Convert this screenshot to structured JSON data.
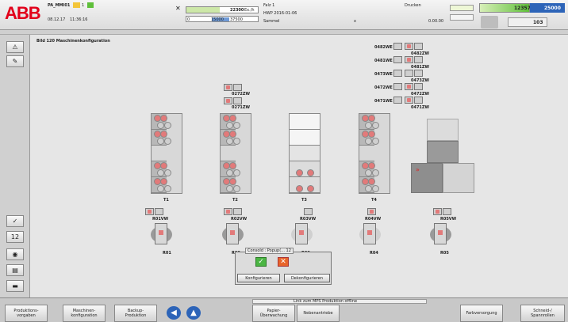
{
  "header": {
    "logo": "ABB",
    "machine": "PA_MMI01",
    "alarm_count": "1",
    "date": "08.12.17",
    "time": "11:36:16",
    "speed_value": "22300",
    "speed_unit": "Ex./h",
    "speed_marker": "15000",
    "speed_max": "37500",
    "speed_min": "0",
    "falz": "Falz 1",
    "product": "HWP 2016-01-06",
    "sammel": "Sammel",
    "sammel_x": "x",
    "druck_label": "Drucken",
    "druck_value": "0.00.00",
    "counter_current": "12357",
    "counter_target": "25000",
    "counter_sub": "103"
  },
  "page": {
    "title": "Bild 120 Maschinenkonfiguration"
  },
  "towers": [
    {
      "label": "T1"
    },
    {
      "label": "T2"
    },
    {
      "label": "T3"
    },
    {
      "label": "T4"
    }
  ],
  "turnbars": {
    "t2_top": "0272ZW",
    "t2_bottom": "0271ZW",
    "rows": [
      "0482WE",
      "0481WE",
      "0473WE",
      "0472WE",
      "0471WE"
    ],
    "right": [
      "0482ZW",
      "0481ZW",
      "0473ZW",
      "0472ZW",
      "0471ZW"
    ]
  },
  "reelstands": [
    {
      "label": "R01",
      "vw": "R01VW"
    },
    {
      "label": "R02",
      "vw": "R02VW"
    },
    {
      "label": "R03",
      "vw": "R03VW"
    },
    {
      "label": "R04",
      "vw": "R04VW"
    },
    {
      "label": "R05",
      "vw": "R05VW"
    }
  ],
  "dialog": {
    "title": "Consold : Popup(... 12",
    "configure": "Konfigurieren",
    "deconfigure": "Dekonfigurieren"
  },
  "status": {
    "message": "Link zum MPS Produktion offline"
  },
  "footer": {
    "b1": "Produktions-\nvorgaben",
    "b2": "Maschinen-\nkonfiguration",
    "b3": "Backup-\nProduktion",
    "b4": "Papier-\nÜberwachung",
    "b5": "Nebenantriebe",
    "b6": "Farbversorgung",
    "b7": "Schneid-/\nSpannrollen"
  },
  "colors": {
    "brand": "#e2001a",
    "accent_green": "#5fbf3a",
    "accent_blue": "#2d64b8"
  }
}
